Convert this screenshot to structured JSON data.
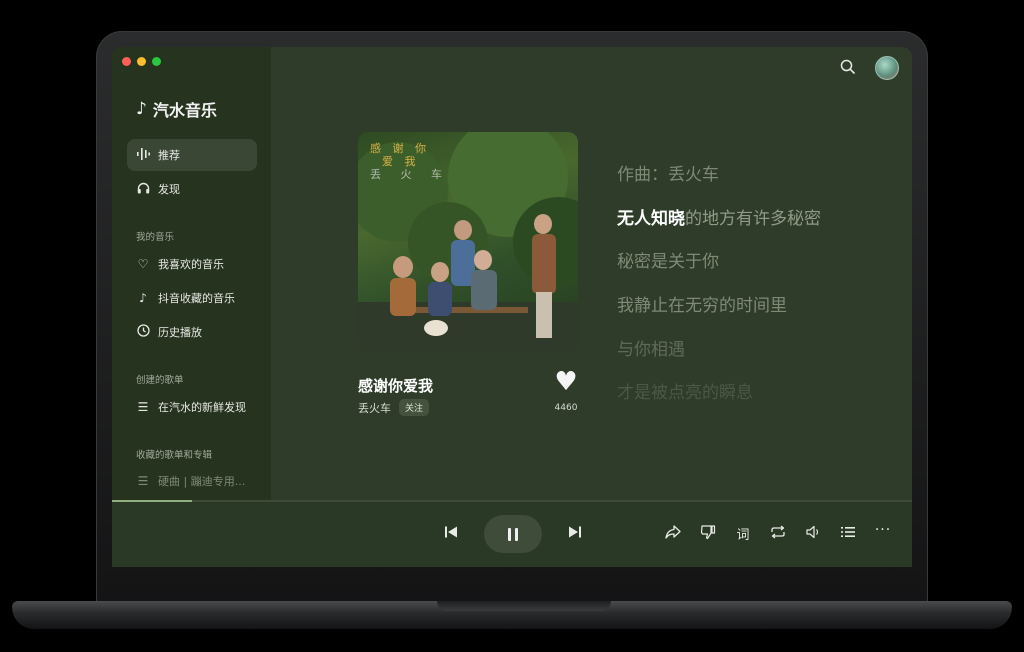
{
  "app": {
    "name": "汽水音乐"
  },
  "sidebar": {
    "nav": [
      {
        "label": "推荐",
        "icon": "waveform-icon",
        "active": true
      },
      {
        "label": "发现",
        "icon": "headphones-icon",
        "active": false
      }
    ],
    "my_music_title": "我的音乐",
    "my_music": [
      {
        "label": "我喜欢的音乐",
        "icon": "heart-icon"
      },
      {
        "label": "抖音收藏的音乐",
        "icon": "tiktok-icon"
      },
      {
        "label": "历史播放",
        "icon": "clock-icon"
      }
    ],
    "created_title": "创建的歌单",
    "created": [
      {
        "label": "在汽水的新鲜发现",
        "icon": "list-icon"
      }
    ],
    "collected_title": "收藏的歌单和专辑",
    "collected": [
      {
        "label": "硬曲 | 蹦迪专用...",
        "icon": "list-icon"
      }
    ]
  },
  "now_playing": {
    "cover_title_line1": "感 谢 你",
    "cover_title_line2": "爱 我",
    "cover_artist": "丢 火 车",
    "title": "感谢你爱我",
    "artist": "丢火车",
    "follow_label": "关注",
    "like_count": "4460",
    "progress": 0.1
  },
  "lyrics": {
    "line0": "作曲：丢火车",
    "line1_sung": "无人知晓",
    "line1_rest": "的地方有许多秘密",
    "line2": "秘密是关于你",
    "line3": "我静止在无穷的时间里",
    "line4": "与你相遇",
    "line5": "才是被点亮的瞬息"
  },
  "player_controls": {
    "lyrics_button_label": "词"
  },
  "colors": {
    "background": "#2e3c29",
    "sidebar": "#26331f",
    "accent": "#8fae7f"
  }
}
